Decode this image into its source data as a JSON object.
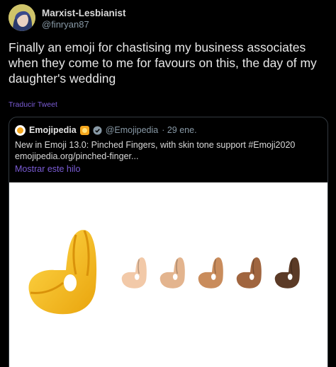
{
  "author": {
    "name": "Marxist-Lesbianist",
    "handle": "@finryan87"
  },
  "tweet": {
    "text": "Finally an emoji for chastising my business associates when they come to me for favours on this, the day of my daughter's wedding",
    "translate_label": "Traducir Tweet"
  },
  "quoted": {
    "name": "Emojipedia",
    "handle": "@Emojipedia",
    "date": "· 29 ene.",
    "text_line1": "New in Emoji 13.0: Pinched Fingers, with skin tone support #Emoji2020",
    "text_line2": "emojipedia.org/pinched-finger...",
    "thread_label": "Mostrar este hilo",
    "image": {
      "subject": "pinched-fingers-emoji",
      "skin_tones": [
        "#f2c9a8",
        "#e3b48e",
        "#c98c5c",
        "#a0653f",
        "#5b3a26"
      ],
      "default_color": "#f7c21c"
    }
  },
  "colors": {
    "background": "#000000",
    "accent": "#7b5cd6",
    "muted": "#8899a6",
    "border": "#333a40"
  }
}
